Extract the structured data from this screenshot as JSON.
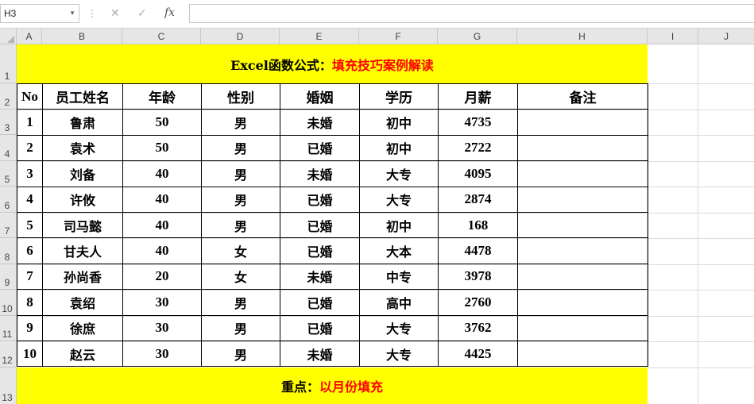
{
  "formula_bar": {
    "name_box": "H3",
    "cancel_icon": "cancel-icon",
    "enter_icon": "check-icon",
    "fx_label": "fx",
    "formula": ""
  },
  "columns": [
    "A",
    "B",
    "C",
    "D",
    "E",
    "F",
    "G",
    "H",
    "I",
    "J"
  ],
  "rows": [
    "1",
    "2",
    "3",
    "4",
    "5",
    "6",
    "7",
    "8",
    "9",
    "10",
    "11",
    "12",
    "13"
  ],
  "sheet": {
    "title_prefix": "Excel函数公式：",
    "title_highlight": "填充技巧案例解读",
    "headers": [
      "No",
      "员工姓名",
      "年龄",
      "性别",
      "婚姻",
      "学历",
      "月薪",
      "备注"
    ],
    "records": [
      [
        "1",
        "鲁肃",
        "50",
        "男",
        "未婚",
        "初中",
        "4735",
        ""
      ],
      [
        "2",
        "袁术",
        "50",
        "男",
        "已婚",
        "初中",
        "2722",
        ""
      ],
      [
        "3",
        "刘备",
        "40",
        "男",
        "未婚",
        "大专",
        "4095",
        ""
      ],
      [
        "4",
        "许攸",
        "40",
        "男",
        "已婚",
        "大专",
        "2874",
        ""
      ],
      [
        "5",
        "司马懿",
        "40",
        "男",
        "已婚",
        "初中",
        "168",
        ""
      ],
      [
        "6",
        "甘夫人",
        "40",
        "女",
        "已婚",
        "大本",
        "4478",
        ""
      ],
      [
        "7",
        "孙尚香",
        "20",
        "女",
        "未婚",
        "中专",
        "3978",
        ""
      ],
      [
        "8",
        "袁绍",
        "30",
        "男",
        "已婚",
        "高中",
        "2760",
        ""
      ],
      [
        "9",
        "徐庶",
        "30",
        "男",
        "已婚",
        "大专",
        "3762",
        ""
      ],
      [
        "10",
        "赵云",
        "30",
        "男",
        "未婚",
        "大专",
        "4425",
        ""
      ]
    ],
    "footer_prefix": "重点：",
    "footer_highlight": "以月份填充"
  },
  "colors": {
    "highlight_fill": "#ffff00",
    "accent_text": "#ff0000",
    "header_bg": "#e6e6e6",
    "gridline": "#dcdcdc"
  }
}
